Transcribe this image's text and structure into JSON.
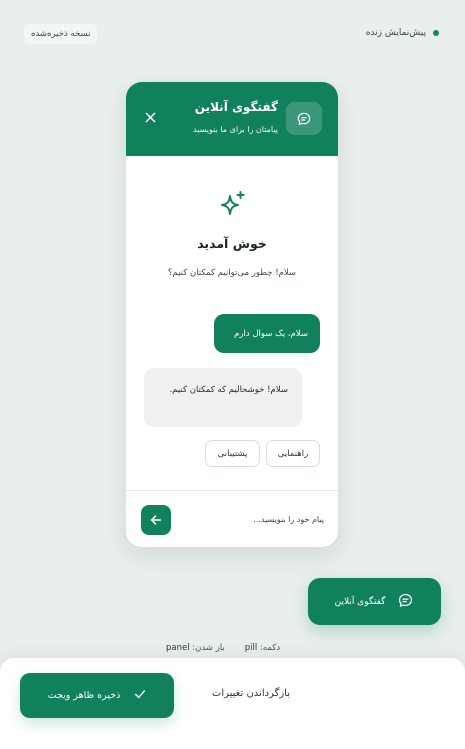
{
  "topbar": {
    "live_preview_label": "پیش‌نمایش زنده",
    "saved_label": "نسخه ذخیره‌شده"
  },
  "widget": {
    "header": {
      "title": "گفتگوی آنلاین",
      "subtitle": "پیامتان را برای ما بنویسید",
      "icon": "chat-bubble-icon",
      "close_icon": "close-icon"
    },
    "welcome": {
      "icon": "sparkle-icon",
      "title": "خوش آمدید",
      "text": "سلام! چطور می‌توانیم کمکتان کنیم؟"
    },
    "messages": {
      "user": "سلام، یک سوال دارم",
      "bot": "سلام! خوشحالیم که کمکتان کنیم."
    },
    "quick_replies": [
      "راهنمایی",
      "پشتیبانی"
    ],
    "composer": {
      "placeholder": "پیام خود را بنویسید...",
      "send_icon": "arrow-left-icon"
    }
  },
  "launcher": {
    "label": "گفتگوی آنلاین",
    "icon": "chat-bubble-icon"
  },
  "meta": {
    "button_label": "دکمه:",
    "button_value": "pill",
    "open_label": "باز شدن:",
    "open_value": "panel"
  },
  "footer": {
    "reset_label": "بازگرداندن تغییرات",
    "save_label": "ذخیره ظاهر ویجت",
    "save_icon": "check-icon"
  },
  "colors": {
    "brand": "#11805c",
    "background": "#e9efeb",
    "bot_bubble": "#eef1ef"
  }
}
